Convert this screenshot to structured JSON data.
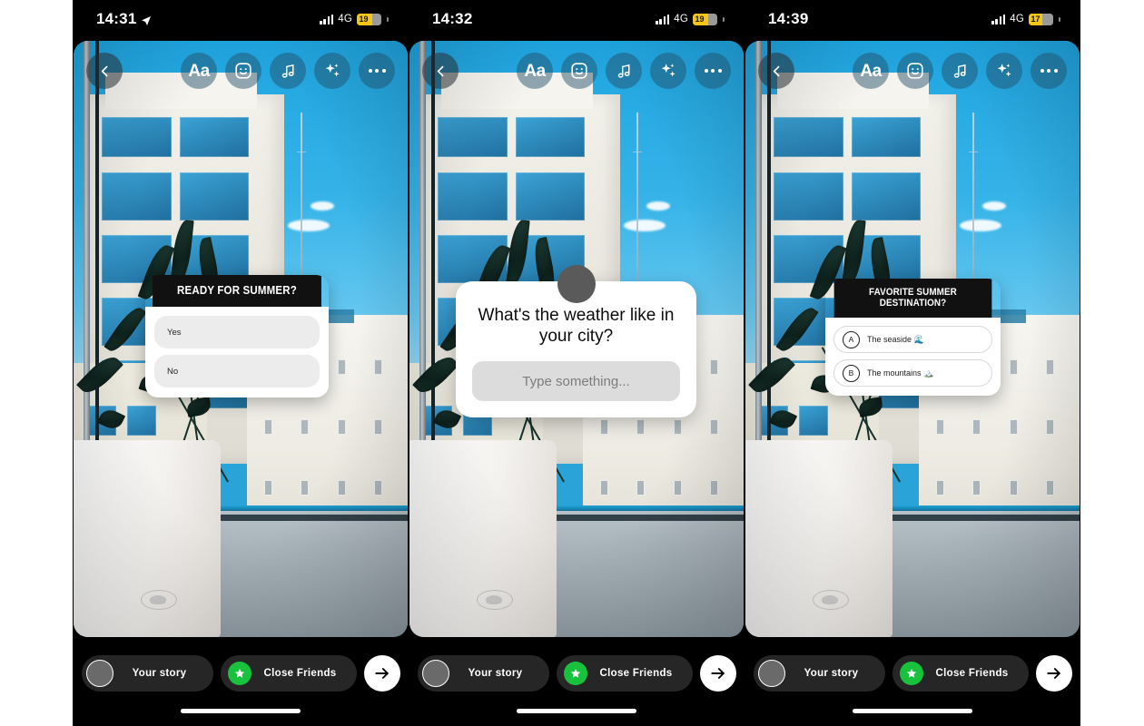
{
  "app": {
    "name": "Instagram Stories Editor",
    "screens_count": 3
  },
  "panels": [
    {
      "id": "panel-poll",
      "status_bar": {
        "time": "14:31",
        "location_icon": "location-arrow-icon",
        "signal_icon": "cellular-signal-icon",
        "network": "4G",
        "battery_percent": "19"
      },
      "toolbar": {
        "back_icon": "chevron-left-icon",
        "buttons": [
          {
            "icon": "text-tool-icon",
            "label": "Aa"
          },
          {
            "icon": "sticker-icon",
            "label": ""
          },
          {
            "icon": "music-note-icon",
            "label": ""
          },
          {
            "icon": "sparkles-icon",
            "label": ""
          },
          {
            "icon": "more-options-icon",
            "label": ""
          }
        ]
      },
      "sticker": {
        "type": "poll",
        "title": "READY FOR SUMMER?",
        "options": [
          {
            "label": "Yes"
          },
          {
            "label": "No"
          }
        ]
      },
      "bottom_bar": {
        "your_story_label": "Your story",
        "close_friends_label": "Close Friends",
        "send_icon": "arrow-right-icon",
        "close_friends_badge_color": "#18c23c"
      }
    },
    {
      "id": "panel-question",
      "status_bar": {
        "time": "14:32",
        "location_icon": "",
        "signal_icon": "cellular-signal-icon",
        "network": "4G",
        "battery_percent": "19"
      },
      "toolbar": {
        "back_icon": "chevron-left-icon",
        "buttons": [
          {
            "icon": "text-tool-icon",
            "label": "Aa"
          },
          {
            "icon": "sticker-icon",
            "label": ""
          },
          {
            "icon": "music-note-icon",
            "label": ""
          },
          {
            "icon": "sparkles-icon",
            "label": ""
          },
          {
            "icon": "more-options-icon",
            "label": ""
          }
        ]
      },
      "sticker": {
        "type": "question",
        "title": "What's the weather like in your city?",
        "input_placeholder": "Type something...",
        "avatar_icon": "profile-avatar"
      },
      "bottom_bar": {
        "your_story_label": "Your story",
        "close_friends_label": "Close Friends",
        "send_icon": "arrow-right-icon",
        "close_friends_badge_color": "#18c23c"
      }
    },
    {
      "id": "panel-quiz",
      "status_bar": {
        "time": "14:39",
        "location_icon": "",
        "signal_icon": "cellular-signal-icon",
        "network": "4G",
        "battery_percent": "17"
      },
      "toolbar": {
        "back_icon": "chevron-left-icon",
        "buttons": [
          {
            "icon": "text-tool-icon",
            "label": "Aa"
          },
          {
            "icon": "sticker-icon",
            "label": ""
          },
          {
            "icon": "music-note-icon",
            "label": ""
          },
          {
            "icon": "sparkles-icon",
            "label": ""
          },
          {
            "icon": "more-options-icon",
            "label": ""
          }
        ]
      },
      "sticker": {
        "type": "quiz",
        "title": "FAVORITE SUMMER DESTINATION?",
        "options": [
          {
            "letter": "A",
            "label": "The seaside 🌊"
          },
          {
            "letter": "B",
            "label": "The mountains 🏔️"
          }
        ]
      },
      "bottom_bar": {
        "your_story_label": "Your story",
        "close_friends_label": "Close Friends",
        "send_icon": "arrow-right-icon",
        "close_friends_badge_color": "#18c23c"
      }
    }
  ],
  "colors": {
    "background": "#ffffff",
    "device_frame": "#000000",
    "sticker_header": "#111111",
    "sticker_body": "#ffffff",
    "poll_option": "#ececec",
    "close_friends_green": "#18c23c",
    "battery_yellow": "#f5c518",
    "chip_background": "#262626"
  }
}
